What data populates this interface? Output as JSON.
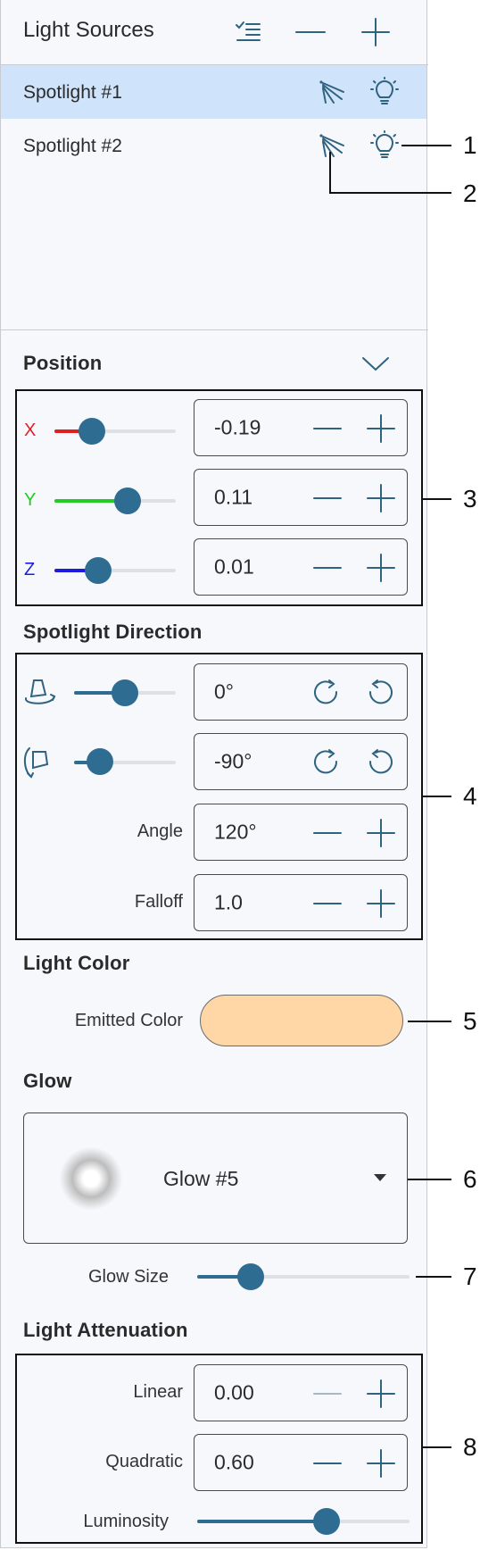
{
  "light_sources": {
    "title": "Light Sources",
    "items": [
      {
        "label": "Spotlight #1",
        "selected": true
      },
      {
        "label": "Spotlight #2",
        "selected": false
      }
    ]
  },
  "position": {
    "title": "Position",
    "axes": [
      {
        "label": "X",
        "color": "#e02020",
        "value": "-0.19",
        "slider_fraction": 0.31
      },
      {
        "label": "Y",
        "color": "#22cc22",
        "value": "0.11",
        "slider_fraction": 0.6
      },
      {
        "label": "Z",
        "color": "#1c1ce0",
        "value": "0.01",
        "slider_fraction": 0.36
      }
    ]
  },
  "spotlight_direction": {
    "title": "Spotlight Direction",
    "rotation1": {
      "value": "0°",
      "slider_fraction": 0.5
    },
    "rotation2": {
      "value": "-90°",
      "slider_fraction": 0.25
    },
    "angle": {
      "label": "Angle",
      "value": "120°"
    },
    "falloff": {
      "label": "Falloff",
      "value": "1.0"
    }
  },
  "light_color": {
    "title": "Light Color",
    "emitted_label": "Emitted Color",
    "color": "#ffd6a6"
  },
  "glow": {
    "title": "Glow",
    "selected": "Glow #5",
    "size_label": "Glow Size",
    "size_fraction": 0.25
  },
  "attenuation": {
    "title": "Light Attenuation",
    "linear": {
      "label": "Linear",
      "value": "0.00"
    },
    "quadratic": {
      "label": "Quadratic",
      "value": "0.60"
    },
    "luminosity": {
      "label": "Luminosity",
      "fraction": 0.61
    }
  },
  "callouts": [
    "1",
    "2",
    "3",
    "4",
    "5",
    "6",
    "7",
    "8"
  ],
  "colors": {
    "accent": "#2e6c92",
    "selection": "#cfe3fb"
  }
}
